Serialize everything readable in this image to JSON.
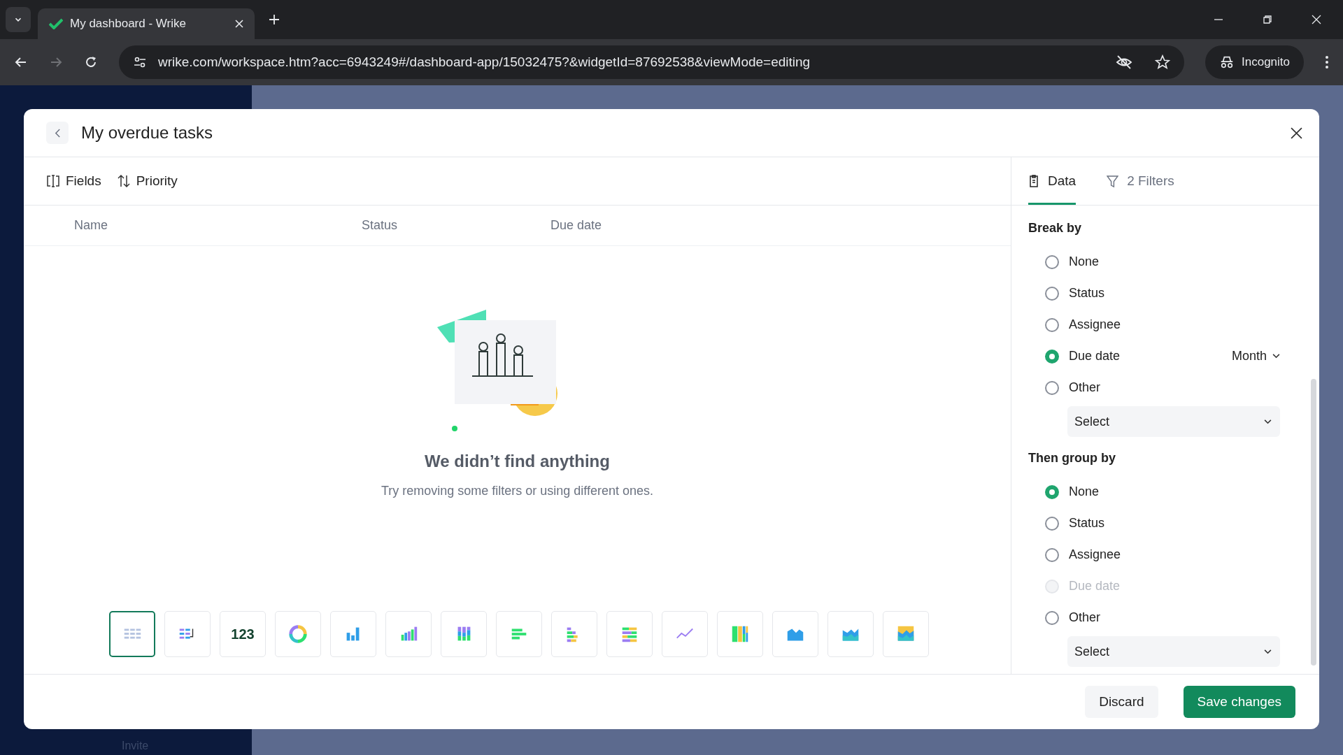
{
  "browser": {
    "tab_title": "My dashboard - Wrike",
    "url": "wrike.com/workspace.htm?acc=6943249#/dashboard-app/15032475?&widgetId=87692538&viewMode=editing",
    "incognito_label": "Incognito"
  },
  "app": {
    "sidebar_footer": "Invite"
  },
  "dialog": {
    "title": "My overdue tasks",
    "toolbar": [
      {
        "kind": "fields",
        "label": "Fields"
      },
      {
        "kind": "sort",
        "label": "Priority"
      }
    ],
    "columns": [
      "Name",
      "Status",
      "Due date"
    ],
    "empty": {
      "title": "We didn’t find anything",
      "message": "Try removing some filters or using different ones."
    },
    "chart_types": [
      {
        "kind": "table",
        "selected": true
      },
      {
        "kind": "pivot",
        "selected": false
      },
      {
        "kind": "number",
        "label": "123",
        "selected": false
      },
      {
        "kind": "donut",
        "selected": false
      },
      {
        "kind": "bar",
        "selected": false
      },
      {
        "kind": "bar-multi",
        "selected": false
      },
      {
        "kind": "stacked-column",
        "selected": false
      },
      {
        "kind": "hbar",
        "selected": false
      },
      {
        "kind": "hbar-stacked",
        "selected": false
      },
      {
        "kind": "hbar-stacked100",
        "selected": false
      },
      {
        "kind": "line",
        "selected": false
      },
      {
        "kind": "column100",
        "selected": false
      },
      {
        "kind": "area",
        "selected": false
      },
      {
        "kind": "area-stacked",
        "selected": false
      },
      {
        "kind": "area100",
        "selected": false
      }
    ],
    "panel_tabs": [
      {
        "kind": "data",
        "label": "Data",
        "selected": true
      },
      {
        "kind": "filter",
        "label": "2 Filters",
        "selected": false
      }
    ],
    "groups": [
      {
        "title": "Break by",
        "options": [
          {
            "label": "None",
            "selected": false,
            "disabled": false
          },
          {
            "label": "Status",
            "selected": false,
            "disabled": false
          },
          {
            "label": "Assignee",
            "selected": false,
            "disabled": false
          },
          {
            "label": "Due date",
            "selected": true,
            "disabled": false,
            "suffix": "Month"
          },
          {
            "label": "Other",
            "selected": false,
            "disabled": false
          }
        ],
        "select": "Select"
      },
      {
        "title": "Then group by",
        "options": [
          {
            "label": "None",
            "selected": true,
            "disabled": false
          },
          {
            "label": "Status",
            "selected": false,
            "disabled": false
          },
          {
            "label": "Assignee",
            "selected": false,
            "disabled": false
          },
          {
            "label": "Due date",
            "selected": false,
            "disabled": true
          },
          {
            "label": "Other",
            "selected": false,
            "disabled": false
          }
        ],
        "select": "Select"
      }
    ],
    "buttons": [
      {
        "kind": "secondary",
        "label": "Discard"
      },
      {
        "kind": "primary",
        "label": "Save changes"
      }
    ]
  }
}
